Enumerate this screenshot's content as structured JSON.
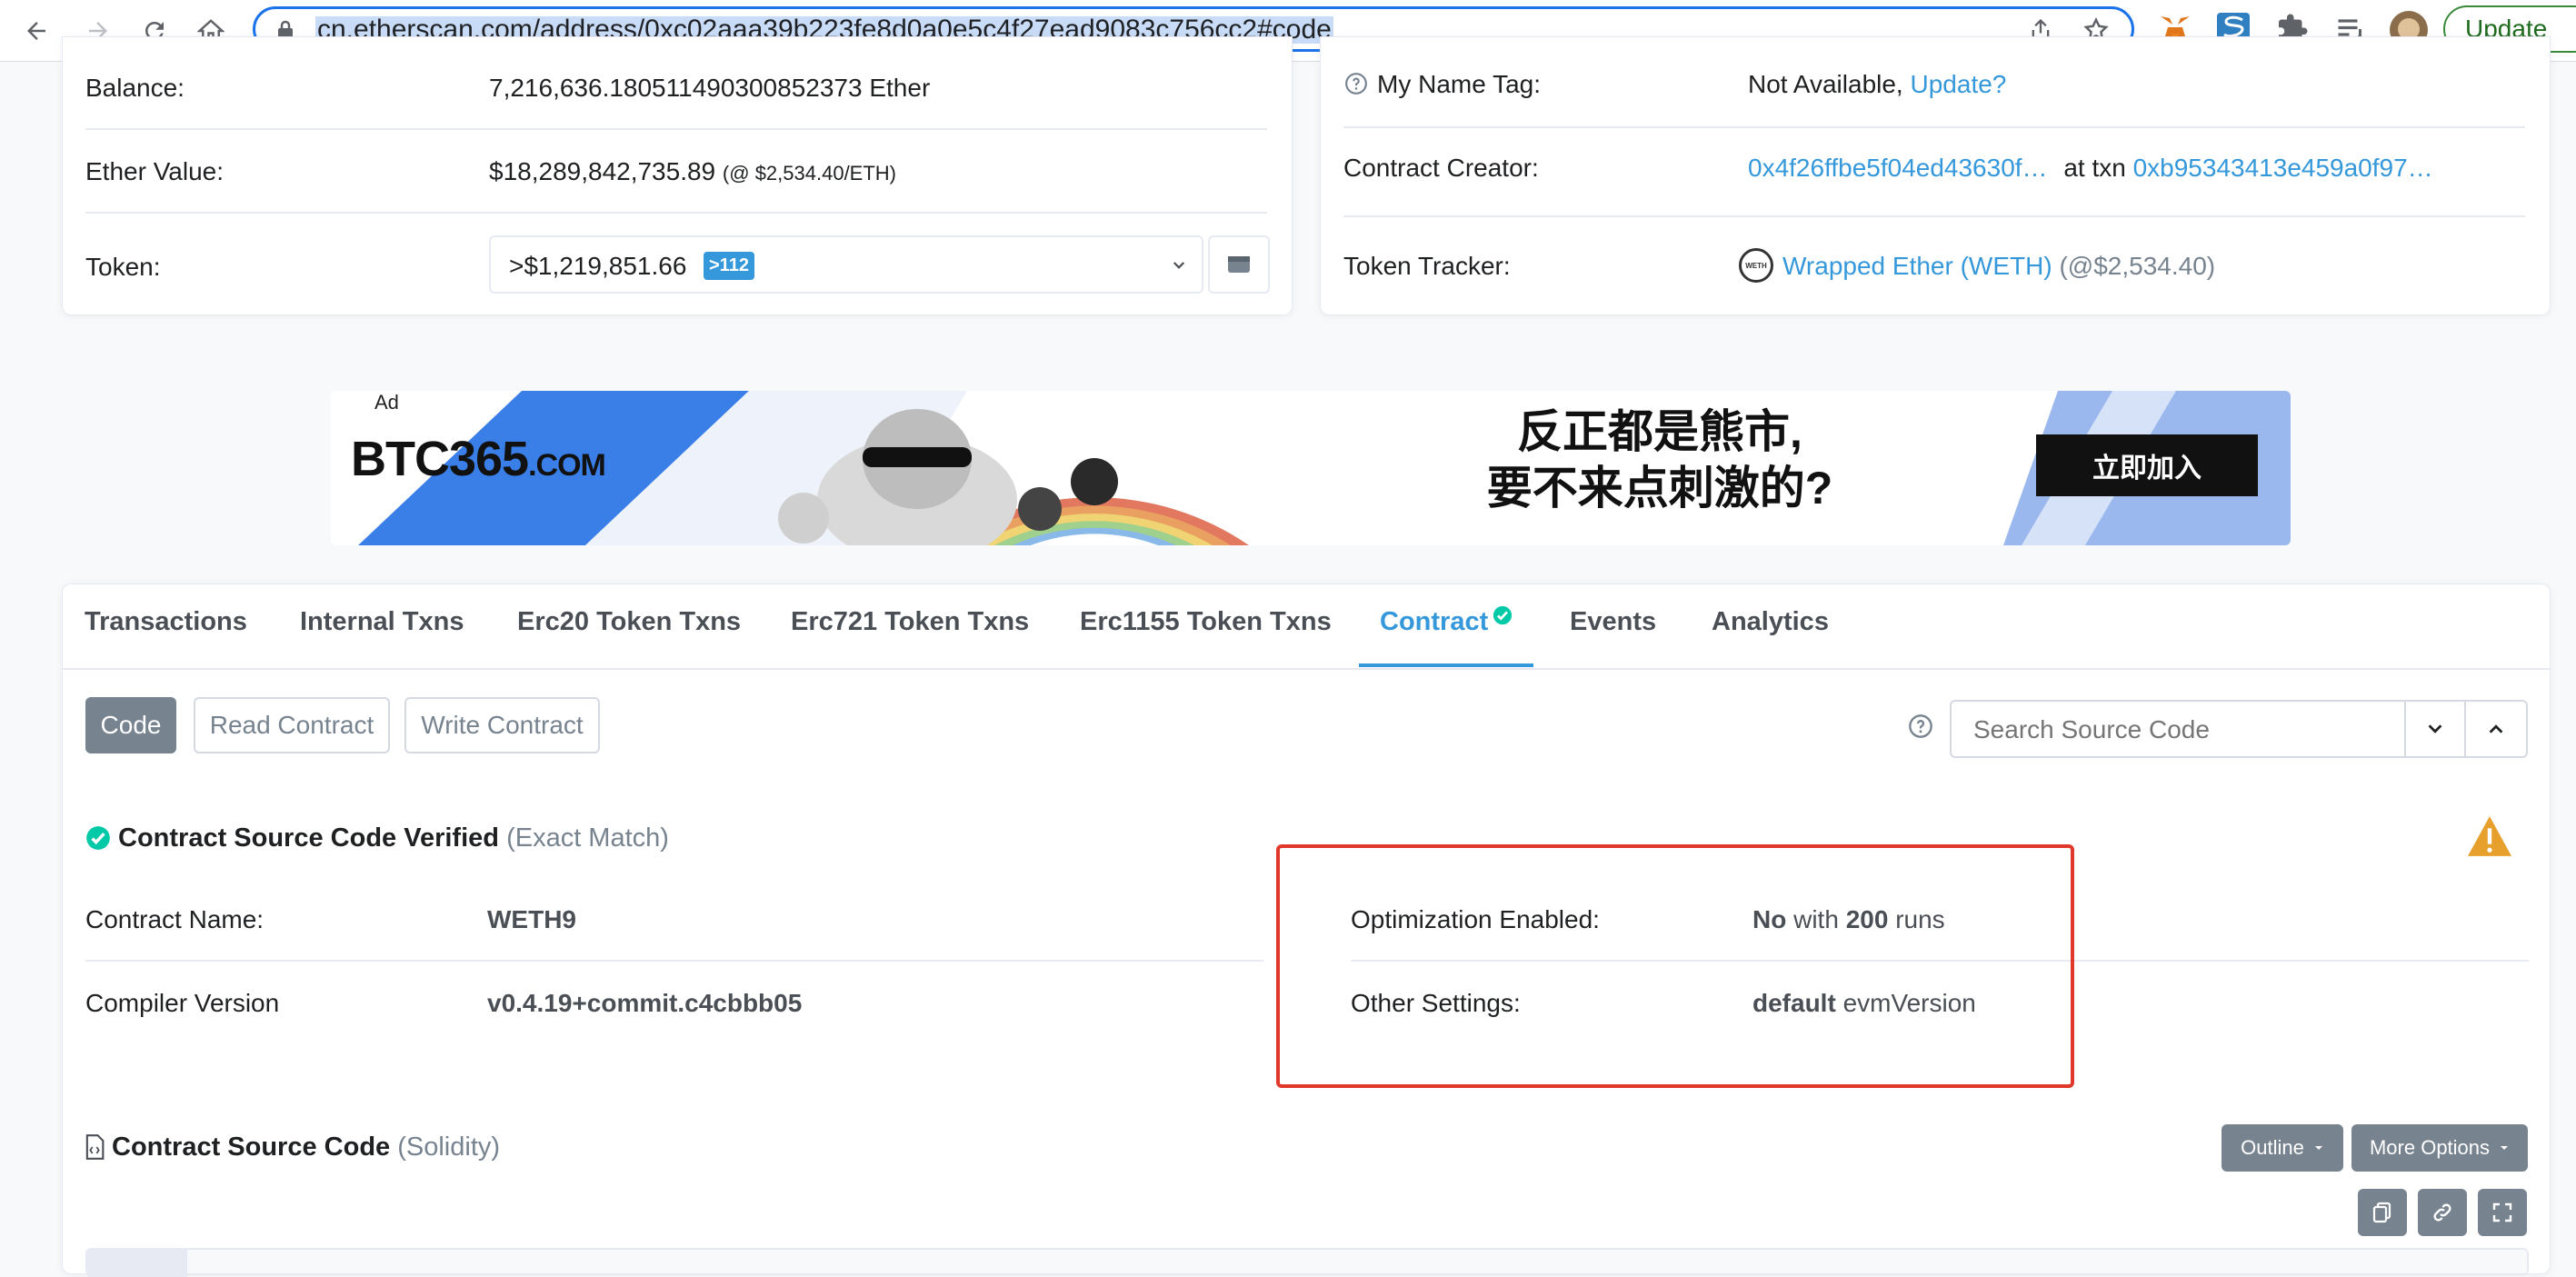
{
  "browser": {
    "url": "cn.etherscan.com/address/0xc02aaa39b223fe8d0a0e5c4f27ead9083c756cc2#code",
    "update_label": "Update"
  },
  "overview": {
    "balance_label": "Balance:",
    "balance_value": "7,216,636.180511490300852373 Ether",
    "ether_value_label": "Ether Value:",
    "ether_value": "$18,289,842,735.89",
    "ether_price_note": "(@ $2,534.40/ETH)",
    "token_label": "Token:",
    "token_value": ">$1,219,851.66",
    "token_count_badge": ">112"
  },
  "more_info": {
    "name_tag_label": "My Name Tag:",
    "name_tag_value": "Not Available,",
    "name_tag_update": "Update?",
    "creator_label": "Contract Creator:",
    "creator_address": "0x4f26ffbe5f04ed43630f…",
    "creator_at_txn": "at txn",
    "creator_txn": "0xb95343413e459a0f97…",
    "token_tracker_label": "Token Tracker:",
    "token_tracker_link": "Wrapped Ether (WETH)",
    "token_tracker_price": "(@$2,534.40)",
    "weth_logo_text": "WETH"
  },
  "ad": {
    "ad_label": "Ad",
    "brand": "BTC365",
    "brand_suffix": ".COM",
    "headline_line1": "反正都是熊市,",
    "headline_line2": "要不来点刺激的?",
    "cta": "立即加入"
  },
  "tabs": [
    {
      "label": "Transactions"
    },
    {
      "label": "Internal Txns"
    },
    {
      "label": "Erc20 Token Txns"
    },
    {
      "label": "Erc721 Token Txns"
    },
    {
      "label": "Erc1155 Token Txns"
    },
    {
      "label": "Contract"
    },
    {
      "label": "Events"
    },
    {
      "label": "Analytics"
    }
  ],
  "contract": {
    "subtabs": [
      "Code",
      "Read Contract",
      "Write Contract"
    ],
    "search_placeholder": "Search Source Code",
    "verified_title": "Contract Source Code Verified",
    "verified_note": "(Exact Match)",
    "name_label": "Contract Name:",
    "name_value": "WETH9",
    "compiler_label": "Compiler Version",
    "compiler_value": "v0.4.19+commit.c4cbbb05",
    "optimization_label": "Optimization Enabled:",
    "optimization_value": "No",
    "optimization_with": "with",
    "optimization_runs": "200",
    "optimization_runs_word": "runs",
    "other_settings_label": "Other Settings:",
    "other_settings_value": "default",
    "other_settings_suffix": "evmVersion",
    "source_title": "Contract Source Code",
    "source_lang": "(Solidity)",
    "outline_label": "Outline",
    "more_options_label": "More Options"
  },
  "colors": {
    "link": "#3498db",
    "highlight_box": "#e0392b",
    "verified_green": "#00c9a7",
    "warning": "#e6a02b",
    "badge": "#3498db"
  }
}
